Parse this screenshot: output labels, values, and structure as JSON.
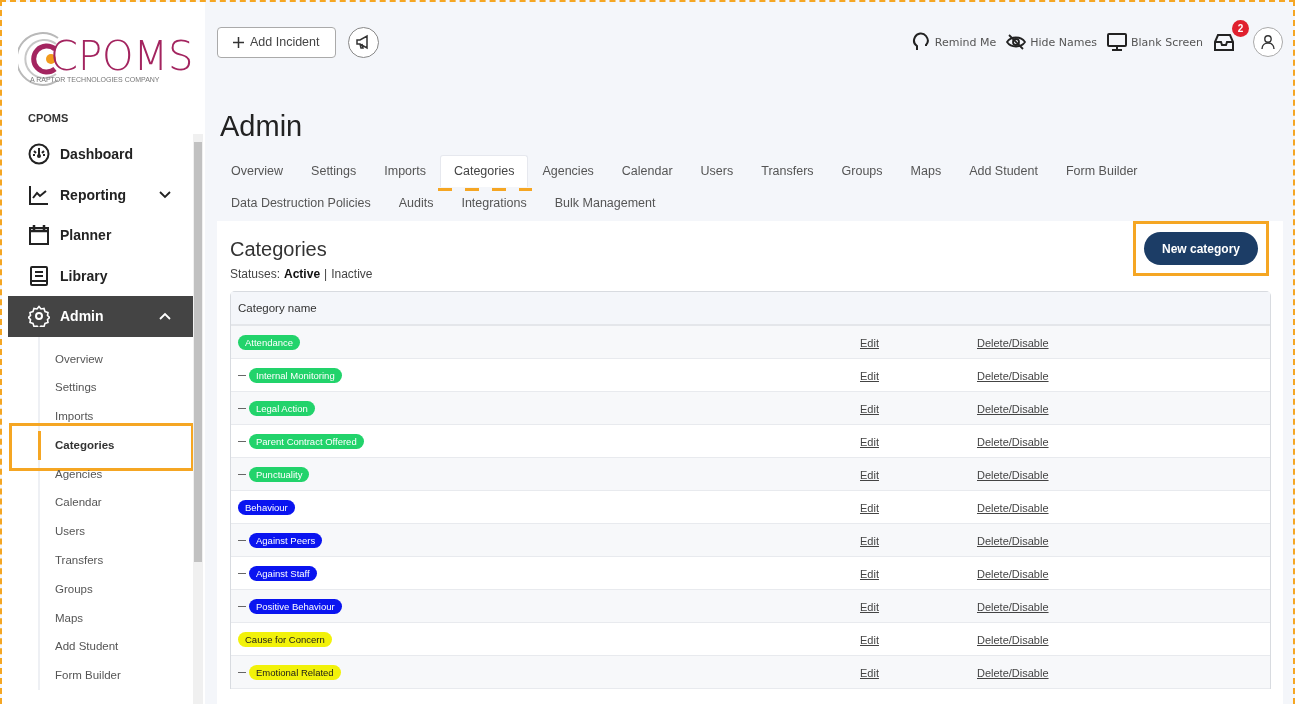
{
  "logo": {
    "name": "CPOMS",
    "tagline": "A RAPTOR TECHNOLOGIES COMPANY"
  },
  "sidebar": {
    "heading": "CPOMS",
    "items": [
      {
        "label": "Dashboard",
        "selected": false
      },
      {
        "label": "Reporting",
        "expanded": false,
        "selected": false
      },
      {
        "label": "Planner",
        "selected": false
      },
      {
        "label": "Library",
        "selected": false
      },
      {
        "label": "Admin",
        "expanded": true,
        "selected": true
      }
    ],
    "sub_items": [
      {
        "label": "Overview",
        "selected": false,
        "highlighted": false
      },
      {
        "label": "Settings",
        "selected": false,
        "highlighted": false
      },
      {
        "label": "Imports",
        "selected": false,
        "highlighted": false
      },
      {
        "label": "Categories",
        "selected": true,
        "highlighted": true
      },
      {
        "label": "Agencies",
        "selected": false,
        "highlighted": false
      },
      {
        "label": "Calendar",
        "selected": false,
        "highlighted": false
      },
      {
        "label": "Users",
        "selected": false,
        "highlighted": false
      },
      {
        "label": "Transfers",
        "selected": false,
        "highlighted": false
      },
      {
        "label": "Groups",
        "selected": false,
        "highlighted": false
      },
      {
        "label": "Maps",
        "selected": false,
        "highlighted": false
      },
      {
        "label": "Add Student",
        "selected": false,
        "highlighted": false
      },
      {
        "label": "Form Builder",
        "selected": false,
        "highlighted": false
      }
    ]
  },
  "header": {
    "add_button": "Add Incident",
    "actions": [
      {
        "label": "Remind Me"
      },
      {
        "label": "Hide Names"
      },
      {
        "label": "Blank Screen"
      }
    ],
    "notifications": "2"
  },
  "page_title": "Admin",
  "tabs": [
    {
      "label": "Overview",
      "selected": false,
      "highlighted": false
    },
    {
      "label": "Settings",
      "selected": false,
      "highlighted": false
    },
    {
      "label": "Imports",
      "selected": false,
      "highlighted": false
    },
    {
      "label": "Categories",
      "selected": true,
      "highlighted": true
    },
    {
      "label": "Agencies",
      "selected": false,
      "highlighted": false
    },
    {
      "label": "Calendar",
      "selected": false,
      "highlighted": false
    },
    {
      "label": "Users",
      "selected": false,
      "highlighted": false
    },
    {
      "label": "Transfers",
      "selected": false,
      "highlighted": false
    },
    {
      "label": "Groups",
      "selected": false,
      "highlighted": false
    },
    {
      "label": "Maps",
      "selected": false,
      "highlighted": false
    },
    {
      "label": "Add Student",
      "selected": false,
      "highlighted": false
    },
    {
      "label": "Form Builder",
      "selected": false,
      "highlighted": false
    },
    {
      "label": "Data Destruction Policies",
      "selected": false,
      "highlighted": false
    },
    {
      "label": "Audits",
      "selected": false,
      "highlighted": false
    },
    {
      "label": "Integrations",
      "selected": false,
      "highlighted": false
    },
    {
      "label": "Bulk Management",
      "selected": false,
      "highlighted": false
    }
  ],
  "section": {
    "title": "Categories",
    "statuses_label": "Statuses:",
    "statuses_separator": "|",
    "statuses": [
      {
        "label": "Active",
        "selected": true
      },
      {
        "label": "Inactive",
        "selected": false
      }
    ],
    "new_button": {
      "label": "New category",
      "highlighted": true
    }
  },
  "table": {
    "columns": [
      "Category name"
    ],
    "rows": [
      {
        "name": "Attendance",
        "color": "#22d36b",
        "edit": "Edit",
        "delete": "Delete/Disable",
        "children": [
          {
            "name": "Internal Monitoring",
            "color": "#22d36b",
            "edit": "Edit",
            "delete": "Delete/Disable"
          },
          {
            "name": "Legal Action",
            "color": "#22d36b",
            "edit": "Edit",
            "delete": "Delete/Disable"
          },
          {
            "name": "Parent Contract Offered",
            "color": "#22d36b",
            "edit": "Edit",
            "delete": "Delete/Disable"
          },
          {
            "name": "Punctuality",
            "color": "#22d36b",
            "edit": "Edit",
            "delete": "Delete/Disable"
          }
        ]
      },
      {
        "name": "Behaviour",
        "color": "#0a14f0",
        "edit": "Edit",
        "delete": "Delete/Disable",
        "children": [
          {
            "name": "Against Peers",
            "color": "#0a14f0",
            "edit": "Edit",
            "delete": "Delete/Disable"
          },
          {
            "name": "Against Staff",
            "color": "#0a14f0",
            "edit": "Edit",
            "delete": "Delete/Disable"
          },
          {
            "name": "Positive Behaviour",
            "color": "#0a14f0",
            "edit": "Edit",
            "delete": "Delete/Disable"
          }
        ]
      },
      {
        "name": "Cause for Concern",
        "color": "#f2f20a",
        "edit": "Edit",
        "delete": "Delete/Disable",
        "children": [
          {
            "name": "Emotional Related",
            "color": "#f2f20a",
            "edit": "Edit",
            "delete": "Delete/Disable"
          }
        ]
      }
    ]
  }
}
